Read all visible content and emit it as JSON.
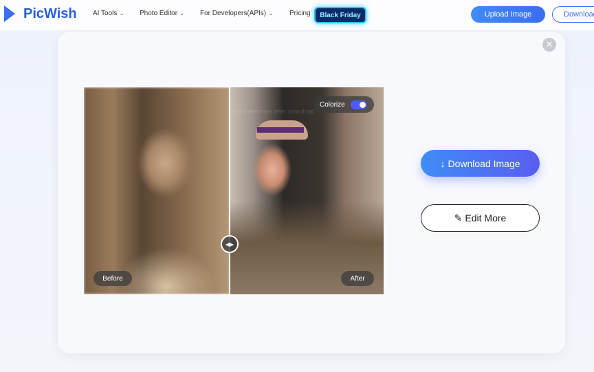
{
  "nav": {
    "brand": "PicWish",
    "items": [
      {
        "label": "AI Tools"
      },
      {
        "label": "Photo Editor"
      },
      {
        "label": "For Developers(APIs)"
      },
      {
        "label": "Pricing"
      }
    ],
    "promo": "Black Friday",
    "upload": "Upload Image",
    "download": "Download"
  },
  "viewer": {
    "colorize_label": "Colorize",
    "colorize_on": true,
    "before_label": "Before",
    "after_label": "After",
    "watermark": "No watermark after download"
  },
  "actions": {
    "download": "Download Image",
    "edit": "Edit More"
  },
  "colors": {
    "accent": "#3c6df0",
    "toggle": "#4f5cf0"
  }
}
